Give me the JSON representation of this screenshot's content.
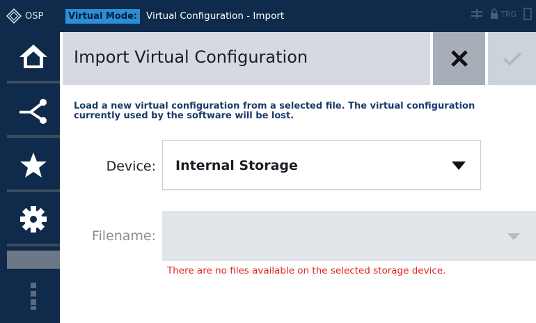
{
  "titlebar": {
    "logo_text": "OSP",
    "mode_label": "Virtual Mode:",
    "window_title": "Virtual Configuration - Import",
    "trg_label": "TRG"
  },
  "sidebar": {
    "items": [
      {
        "name": "home",
        "icon": "home-icon"
      },
      {
        "name": "connections",
        "icon": "share-icon"
      },
      {
        "name": "favorites",
        "icon": "star-icon"
      },
      {
        "name": "settings",
        "icon": "gear-icon"
      }
    ],
    "more_icon": "more-vertical-icon"
  },
  "dialog": {
    "title": "Import Virtual Configuration",
    "description": "Load a new virtual configuration from a selected file. The virtual configuration currently used by the software will be lost.",
    "device_label": "Device:",
    "device_value": "Internal Storage",
    "filename_label": "Filename:",
    "filename_value": "",
    "error_message": "There are no files available on the selected storage device."
  },
  "colors": {
    "titlebar_bg": "#0f2a4a",
    "mode_badge_bg": "#2a8fd6",
    "error": "#e02020",
    "description_text": "#1a3a6a"
  }
}
